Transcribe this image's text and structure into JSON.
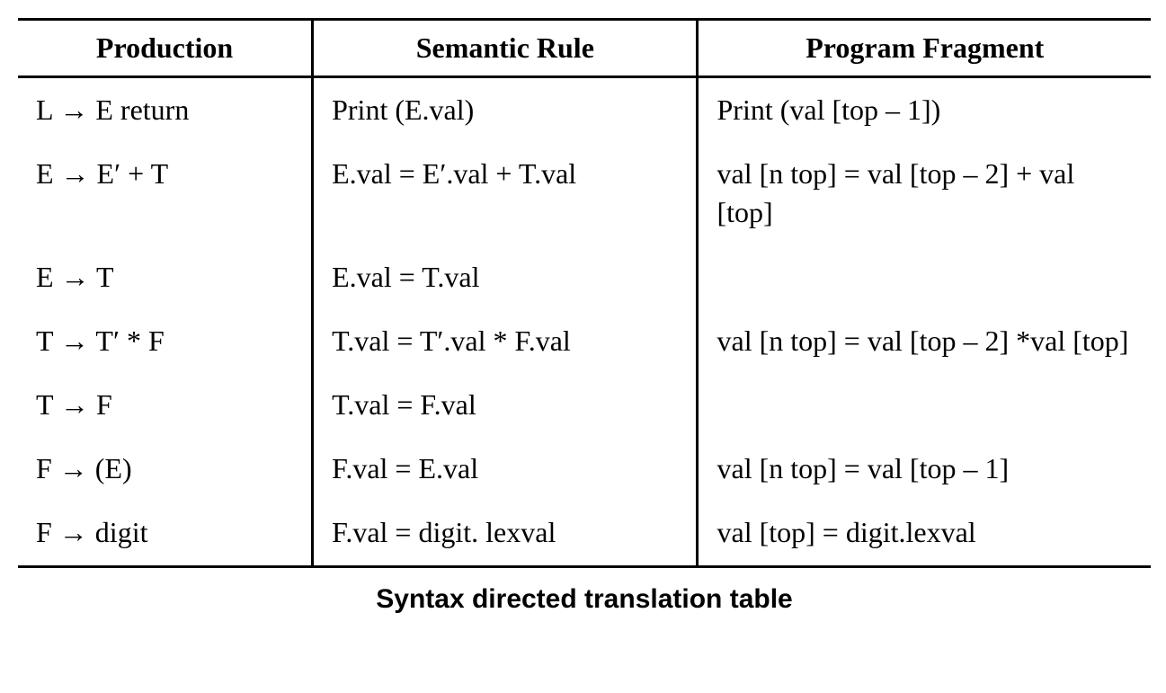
{
  "headers": {
    "production": "Production",
    "semantic": "Semantic Rule",
    "fragment": "Program Fragment"
  },
  "rows": [
    {
      "production": "L → E return",
      "semantic": "Print (E.val)",
      "fragment": "Print (val [top – 1])"
    },
    {
      "production": "E → E′ + T",
      "semantic": "E.val = E′.val + T.val",
      "fragment": "val [n top] = val [top – 2] + val [top]"
    },
    {
      "production": "E → T",
      "semantic": "E.val = T.val",
      "fragment": ""
    },
    {
      "production": "T → T′ * F",
      "semantic": "T.val = T′.val * F.val",
      "fragment": "val [n top] = val [top – 2] *val [top]"
    },
    {
      "production": "T → F",
      "semantic": "T.val = F.val",
      "fragment": ""
    },
    {
      "production": "F → (E)",
      "semantic": "F.val = E.val",
      "fragment": "val [n top] = val [top – 1]"
    },
    {
      "production": "F → digit",
      "semantic": "F.val = digit. lexval",
      "fragment": "val [top] = digit.lexval"
    }
  ],
  "caption": "Syntax directed translation table"
}
